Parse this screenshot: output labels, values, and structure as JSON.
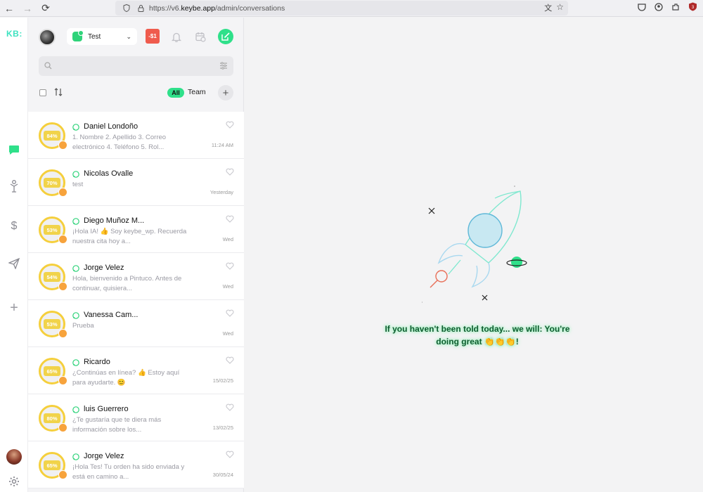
{
  "browser": {
    "url_prefix": "https://v6.",
    "url_domain": "keybe.app",
    "url_path": "/admin/conversations"
  },
  "rail": {
    "logo": "KB:"
  },
  "header": {
    "app_selector": "Test",
    "alert_badge": "-$1",
    "accent_color": "#2fe08a"
  },
  "search": {
    "placeholder": ""
  },
  "filters": {
    "all_label": "All",
    "team_label": "Team"
  },
  "conversations": [
    {
      "name": "Daniel Londoño",
      "percent": "84%",
      "preview": "1. Nombre 2. Apellido 3. Correo electrónico 4. Teléfono 5. Rol...",
      "time": "11:24 AM"
    },
    {
      "name": "Nicolas Ovalle",
      "percent": "70%",
      "preview": "test",
      "time": "Yesterday"
    },
    {
      "name": "Diego Muñoz M...",
      "percent": "53%",
      "preview": "¡Hola IA! 👍 Soy keybe_wp. Recuerda nuestra cita hoy a...",
      "time": "Wed"
    },
    {
      "name": "Jorge Velez",
      "percent": "54%",
      "preview": "Hola, bienvenido a Pintuco. Antes de continuar, quisiera...",
      "time": "Wed"
    },
    {
      "name": "Vanessa Cam...",
      "percent": "53%",
      "preview": "Prueba",
      "time": "Wed"
    },
    {
      "name": "Ricardo",
      "percent": "65%",
      "preview": "¿Continúas en línea? 👍 Estoy aquí para ayudarte. 😊",
      "time": "15/02/25"
    },
    {
      "name": "luis Guerrero",
      "percent": "80%",
      "preview": "¿Te gustaría que te diera más información sobre los...",
      "time": "13/02/25"
    },
    {
      "name": "Jorge Velez",
      "percent": "65%",
      "preview": "¡Hola Tes! Tu orden ha sido enviada y está en camino a...",
      "time": "30/05/24"
    }
  ],
  "main": {
    "empty_message": "If you haven't been told today... we will: You're doing great 👏👏👏!"
  }
}
